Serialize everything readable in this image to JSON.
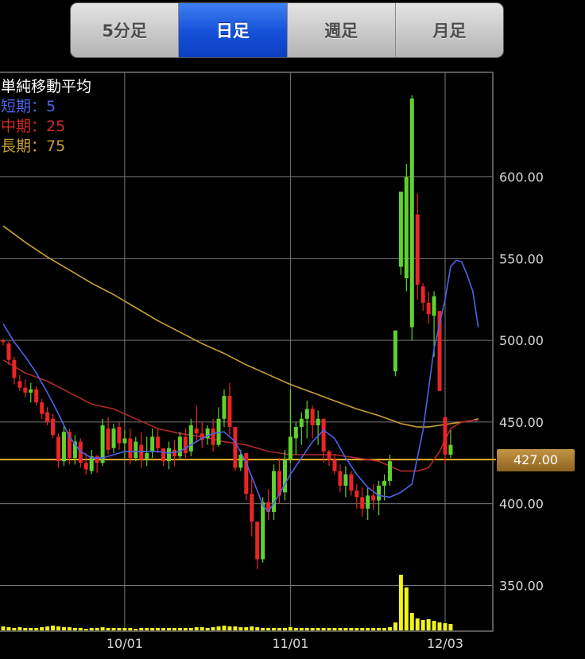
{
  "tabs": [
    {
      "label": "5分足",
      "active": false
    },
    {
      "label": "日足",
      "active": true
    },
    {
      "label": "週足",
      "active": false
    },
    {
      "label": "月足",
      "active": false
    }
  ],
  "legend": {
    "title": "単純移動平均",
    "short": "短期：5",
    "mid": "中期：25",
    "long": "長期：75"
  },
  "current_price": "427.00",
  "colors": {
    "up": "#5fd22e",
    "down": "#ea2525",
    "ma_short": "#4a64e8",
    "ma_mid": "#b02a2a",
    "ma_long": "#c8a036",
    "price_line": "#f5b12e",
    "volume": "#f2f21c",
    "grid": "#777777"
  },
  "chart_data": {
    "type": "candlestick",
    "y_ticks": [
      350,
      400,
      450,
      500,
      550,
      600
    ],
    "y_tick_labels": [
      "350.00",
      "400.00",
      "450.00",
      "500.00",
      "550.00",
      "600.00"
    ],
    "ylim": [
      322,
      664
    ],
    "x_ticks": [
      {
        "index": 22,
        "label": "10/01"
      },
      {
        "index": 52,
        "label": "11/01"
      },
      {
        "index": 80,
        "label": "12/03"
      }
    ],
    "current_price": 427,
    "candles": [
      [
        500,
        501,
        497,
        499
      ],
      [
        498,
        499,
        485,
        488
      ],
      [
        488,
        490,
        473,
        477
      ],
      [
        475,
        479,
        469,
        471
      ],
      [
        471,
        476,
        465,
        468
      ],
      [
        468,
        474,
        462,
        470
      ],
      [
        470,
        472,
        460,
        462
      ],
      [
        462,
        464,
        452,
        455
      ],
      [
        456,
        459,
        448,
        450
      ],
      [
        452,
        455,
        440,
        442
      ],
      [
        441,
        443,
        422,
        426
      ],
      [
        426,
        448,
        423,
        444
      ],
      [
        444,
        446,
        424,
        428
      ],
      [
        428,
        442,
        424,
        438
      ],
      [
        438,
        440,
        422,
        425
      ],
      [
        425,
        431,
        418,
        421
      ],
      [
        420,
        433,
        418,
        429
      ],
      [
        429,
        430,
        419,
        425
      ],
      [
        425,
        452,
        423,
        448
      ],
      [
        446,
        453,
        430,
        433
      ],
      [
        434,
        449,
        431,
        446
      ],
      [
        447,
        450,
        433,
        437
      ],
      [
        437,
        445,
        428,
        440
      ],
      [
        440,
        446,
        424,
        428
      ],
      [
        428,
        441,
        426,
        438
      ],
      [
        436,
        444,
        422,
        427
      ],
      [
        427,
        441,
        423,
        431
      ],
      [
        432,
        446,
        428,
        441
      ],
      [
        441,
        446,
        431,
        434
      ],
      [
        434,
        433,
        423,
        426
      ],
      [
        426,
        438,
        421,
        434
      ],
      [
        433,
        439,
        423,
        429
      ],
      [
        429,
        444,
        427,
        441
      ],
      [
        441,
        446,
        428,
        431
      ],
      [
        432,
        452,
        429,
        448
      ],
      [
        446,
        460,
        438,
        443
      ],
      [
        443,
        450,
        434,
        439
      ],
      [
        440,
        448,
        436,
        446
      ],
      [
        446,
        452,
        432,
        436
      ],
      [
        436,
        459,
        435,
        452
      ],
      [
        452,
        470,
        447,
        466
      ],
      [
        466,
        474,
        442,
        447
      ],
      [
        447,
        442,
        420,
        422
      ],
      [
        422,
        433,
        420,
        430
      ],
      [
        431,
        430,
        402,
        406
      ],
      [
        406,
        416,
        380,
        389
      ],
      [
        389,
        383,
        360,
        366
      ],
      [
        366,
        404,
        364,
        401
      ],
      [
        401,
        409,
        390,
        395
      ],
      [
        395,
        424,
        390,
        420
      ],
      [
        420,
        428,
        400,
        405
      ],
      [
        407,
        433,
        402,
        427
      ],
      [
        427,
        470,
        425,
        441
      ],
      [
        440,
        450,
        430,
        447
      ],
      [
        447,
        456,
        436,
        452
      ],
      [
        452,
        463,
        440,
        458
      ],
      [
        458,
        460,
        440,
        448
      ],
      [
        448,
        457,
        436,
        452
      ],
      [
        452,
        450,
        425,
        432
      ],
      [
        432,
        433,
        423,
        427
      ],
      [
        427,
        430,
        418,
        420
      ],
      [
        420,
        424,
        407,
        411
      ],
      [
        411,
        423,
        404,
        418
      ],
      [
        418,
        420,
        405,
        408
      ],
      [
        408,
        412,
        397,
        404
      ],
      [
        404,
        410,
        392,
        397
      ],
      [
        397,
        410,
        390,
        405
      ],
      [
        405,
        412,
        396,
        402
      ],
      [
        402,
        414,
        393,
        411
      ],
      [
        411,
        418,
        402,
        414
      ],
      [
        414,
        430,
        411,
        426
      ],
      [
        481,
        506,
        478,
        506
      ],
      [
        545,
        586,
        540,
        591
      ],
      [
        538,
        608,
        530,
        600
      ],
      [
        508,
        650,
        500,
        648
      ],
      [
        577,
        590,
        525,
        534
      ],
      [
        533,
        535,
        518,
        523
      ],
      [
        523,
        530,
        510,
        516
      ],
      [
        515,
        530,
        490,
        527
      ],
      [
        518,
        503,
        474,
        469
      ],
      [
        453,
        446,
        425,
        430
      ],
      [
        430,
        445,
        428,
        436
      ]
    ],
    "ma_short": [
      [
        0,
        510
      ],
      [
        2,
        499
      ],
      [
        4,
        490
      ],
      [
        6,
        480
      ],
      [
        8,
        468
      ],
      [
        10,
        455
      ],
      [
        12,
        441
      ],
      [
        14,
        432
      ],
      [
        16,
        428
      ],
      [
        18,
        428
      ],
      [
        20,
        430
      ],
      [
        22,
        432
      ],
      [
        24,
        432
      ],
      [
        26,
        432
      ],
      [
        28,
        432
      ],
      [
        30,
        431
      ],
      [
        32,
        432
      ],
      [
        34,
        436
      ],
      [
        36,
        440
      ],
      [
        38,
        443
      ],
      [
        40,
        444
      ],
      [
        42,
        438
      ],
      [
        44,
        425
      ],
      [
        46,
        408
      ],
      [
        47,
        399
      ],
      [
        48,
        395
      ],
      [
        50,
        406
      ],
      [
        52,
        418
      ],
      [
        54,
        428
      ],
      [
        56,
        438
      ],
      [
        58,
        445
      ],
      [
        60,
        440
      ],
      [
        62,
        428
      ],
      [
        64,
        418
      ],
      [
        66,
        410
      ],
      [
        68,
        405
      ],
      [
        70,
        404
      ],
      [
        72,
        407
      ],
      [
        74,
        412
      ],
      [
        76,
        445
      ],
      [
        78,
        495
      ],
      [
        80,
        525
      ],
      [
        81,
        545
      ],
      [
        82,
        549
      ],
      [
        83,
        548
      ],
      [
        84,
        540
      ],
      [
        85,
        530
      ],
      [
        86,
        508
      ]
    ],
    "ma_mid": [
      [
        0,
        488
      ],
      [
        4,
        480
      ],
      [
        8,
        475
      ],
      [
        12,
        468
      ],
      [
        16,
        461
      ],
      [
        20,
        458
      ],
      [
        24,
        452
      ],
      [
        28,
        446
      ],
      [
        32,
        443
      ],
      [
        36,
        441
      ],
      [
        40,
        438
      ],
      [
        44,
        436
      ],
      [
        48,
        432
      ],
      [
        52,
        430
      ],
      [
        56,
        430
      ],
      [
        60,
        430
      ],
      [
        64,
        428
      ],
      [
        68,
        426
      ],
      [
        72,
        420
      ],
      [
        75,
        420
      ],
      [
        77,
        422
      ],
      [
        79,
        432
      ],
      [
        81,
        446
      ],
      [
        83,
        450
      ],
      [
        85,
        451
      ],
      [
        86,
        451
      ]
    ],
    "ma_long": [
      [
        0,
        570
      ],
      [
        4,
        560
      ],
      [
        8,
        551
      ],
      [
        12,
        543
      ],
      [
        16,
        535
      ],
      [
        20,
        528
      ],
      [
        24,
        520
      ],
      [
        28,
        512
      ],
      [
        32,
        505
      ],
      [
        36,
        498
      ],
      [
        40,
        492
      ],
      [
        44,
        485
      ],
      [
        48,
        479
      ],
      [
        52,
        473
      ],
      [
        56,
        468
      ],
      [
        60,
        463
      ],
      [
        64,
        458
      ],
      [
        68,
        454
      ],
      [
        72,
        449
      ],
      [
        75,
        447
      ],
      [
        77,
        447
      ],
      [
        79,
        448
      ],
      [
        81,
        449
      ],
      [
        83,
        450
      ],
      [
        85,
        451
      ],
      [
        86,
        452
      ]
    ],
    "volume": [
      5,
      4,
      3,
      4,
      3,
      3,
      3,
      4,
      5,
      6,
      5,
      4,
      4,
      3,
      3,
      2,
      3,
      3,
      4,
      3,
      3,
      3,
      3,
      3,
      2,
      3,
      3,
      3,
      3,
      3,
      3,
      3,
      3,
      3,
      3,
      4,
      4,
      3,
      4,
      5,
      6,
      5,
      5,
      4,
      4,
      5,
      4,
      3,
      3,
      3,
      3,
      3,
      4,
      3,
      3,
      3,
      3,
      3,
      3,
      3,
      3,
      3,
      3,
      3,
      3,
      3,
      3,
      3,
      3,
      3,
      4,
      10,
      70,
      54,
      22,
      15,
      13,
      14,
      12,
      10,
      9,
      8
    ]
  }
}
